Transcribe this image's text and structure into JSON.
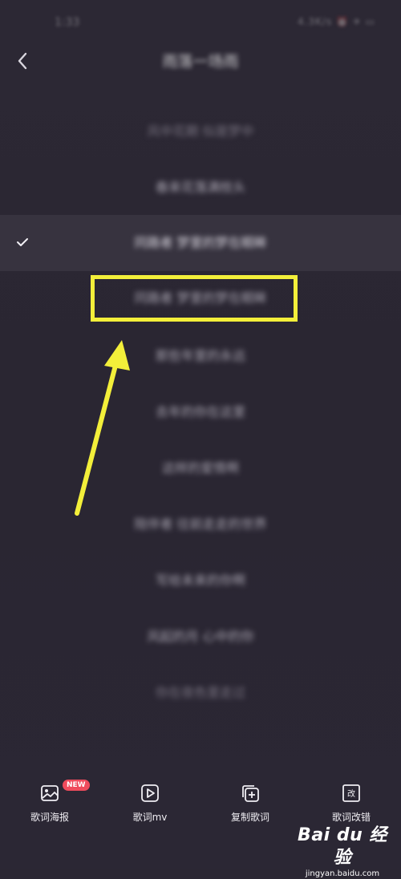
{
  "status_bar": {
    "time": "1:33",
    "icons_text": "4.3K/s ⏰ ✈ ▭"
  },
  "header": {
    "title": "雨落一场雨"
  },
  "lyrics": [
    {
      "text": "风中花期 似是梦中",
      "color": "#77727f"
    },
    {
      "text": "春来花落满枝头",
      "color": "#a8a4b0"
    },
    {
      "text": "同路者 梦里的梦在眼眸",
      "color": "#dedbe4",
      "selected": true
    },
    {
      "text": "同路者 梦里的梦在眼眸",
      "color": "#a8a4b0"
    },
    {
      "text": "那些年里的永远",
      "color": "#a8a4b0"
    },
    {
      "text": "去年的你在这里",
      "color": "#a8a4b0"
    },
    {
      "text": "这样的爱情啊",
      "color": "#a8a4b0"
    },
    {
      "text": "陪伴者 往前走走的世界",
      "color": "#a8a4b0"
    },
    {
      "text": "写给未来的你啊",
      "color": "#a8a4b0"
    },
    {
      "text": "风起的月 心中的你",
      "color": "#a8a4b0"
    },
    {
      "text": "你在夜色里走过",
      "color": "#77727f"
    }
  ],
  "toolbar": {
    "items": [
      {
        "label": "歌词海报",
        "badge": "NEW",
        "icon": "lyric-poster-icon"
      },
      {
        "label": "歌词mv",
        "icon": "lyric-mv-icon"
      },
      {
        "label": "复制歌词",
        "icon": "copy-lyrics-icon"
      },
      {
        "label": "歌词改错",
        "icon": "lyric-correct-icon"
      }
    ]
  },
  "colors": {
    "background": "#2b2733",
    "selected_row": "#37333f",
    "annotation": "#f3ef3a",
    "badge": "#ef4b5c"
  },
  "watermark": {
    "logo": "Bai du 经验",
    "url": "jingyan.baidu.com"
  }
}
